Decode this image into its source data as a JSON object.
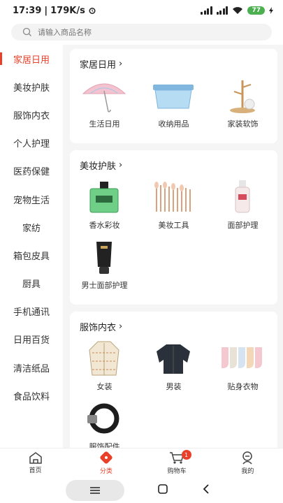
{
  "status": {
    "time": "17:39",
    "speed": "179K/s",
    "battery": "77"
  },
  "search": {
    "placeholder": "请输入商品名称"
  },
  "sidebar": {
    "items": [
      {
        "label": "家居日用"
      },
      {
        "label": "美妆护肤"
      },
      {
        "label": "服饰内衣"
      },
      {
        "label": "个人护理"
      },
      {
        "label": "医药保健"
      },
      {
        "label": "宠物生活"
      },
      {
        "label": "家纺"
      },
      {
        "label": "箱包皮具"
      },
      {
        "label": "厨具"
      },
      {
        "label": "手机通讯"
      },
      {
        "label": "日用百货"
      },
      {
        "label": "清洁纸品"
      },
      {
        "label": "食品饮料"
      }
    ]
  },
  "sections": [
    {
      "title": "家居日用",
      "items": [
        {
          "label": "生活日用",
          "icon": "umbrella-icon"
        },
        {
          "label": "收纳用品",
          "icon": "storage-box-icon"
        },
        {
          "label": "家装软饰",
          "icon": "decor-tree-icon"
        }
      ]
    },
    {
      "title": "美妆护肤",
      "items": [
        {
          "label": "香水彩妆",
          "icon": "perfume-icon"
        },
        {
          "label": "美妆工具",
          "icon": "makeup-brush-icon"
        },
        {
          "label": "面部护理",
          "icon": "serum-bottle-icon"
        },
        {
          "label": "男士面部护理",
          "icon": "face-wash-tube-icon"
        }
      ]
    },
    {
      "title": "服饰内衣",
      "items": [
        {
          "label": "女装",
          "icon": "cardigan-icon"
        },
        {
          "label": "男装",
          "icon": "jacket-icon"
        },
        {
          "label": "贴身衣物",
          "icon": "socks-icon"
        },
        {
          "label": "服饰配件",
          "icon": "belt-icon"
        }
      ]
    }
  ],
  "nav": {
    "home": "首页",
    "category": "分类",
    "cart": "购物车",
    "cart_badge": "1",
    "me": "我的"
  },
  "colors": {
    "accent": "#e8402a"
  }
}
